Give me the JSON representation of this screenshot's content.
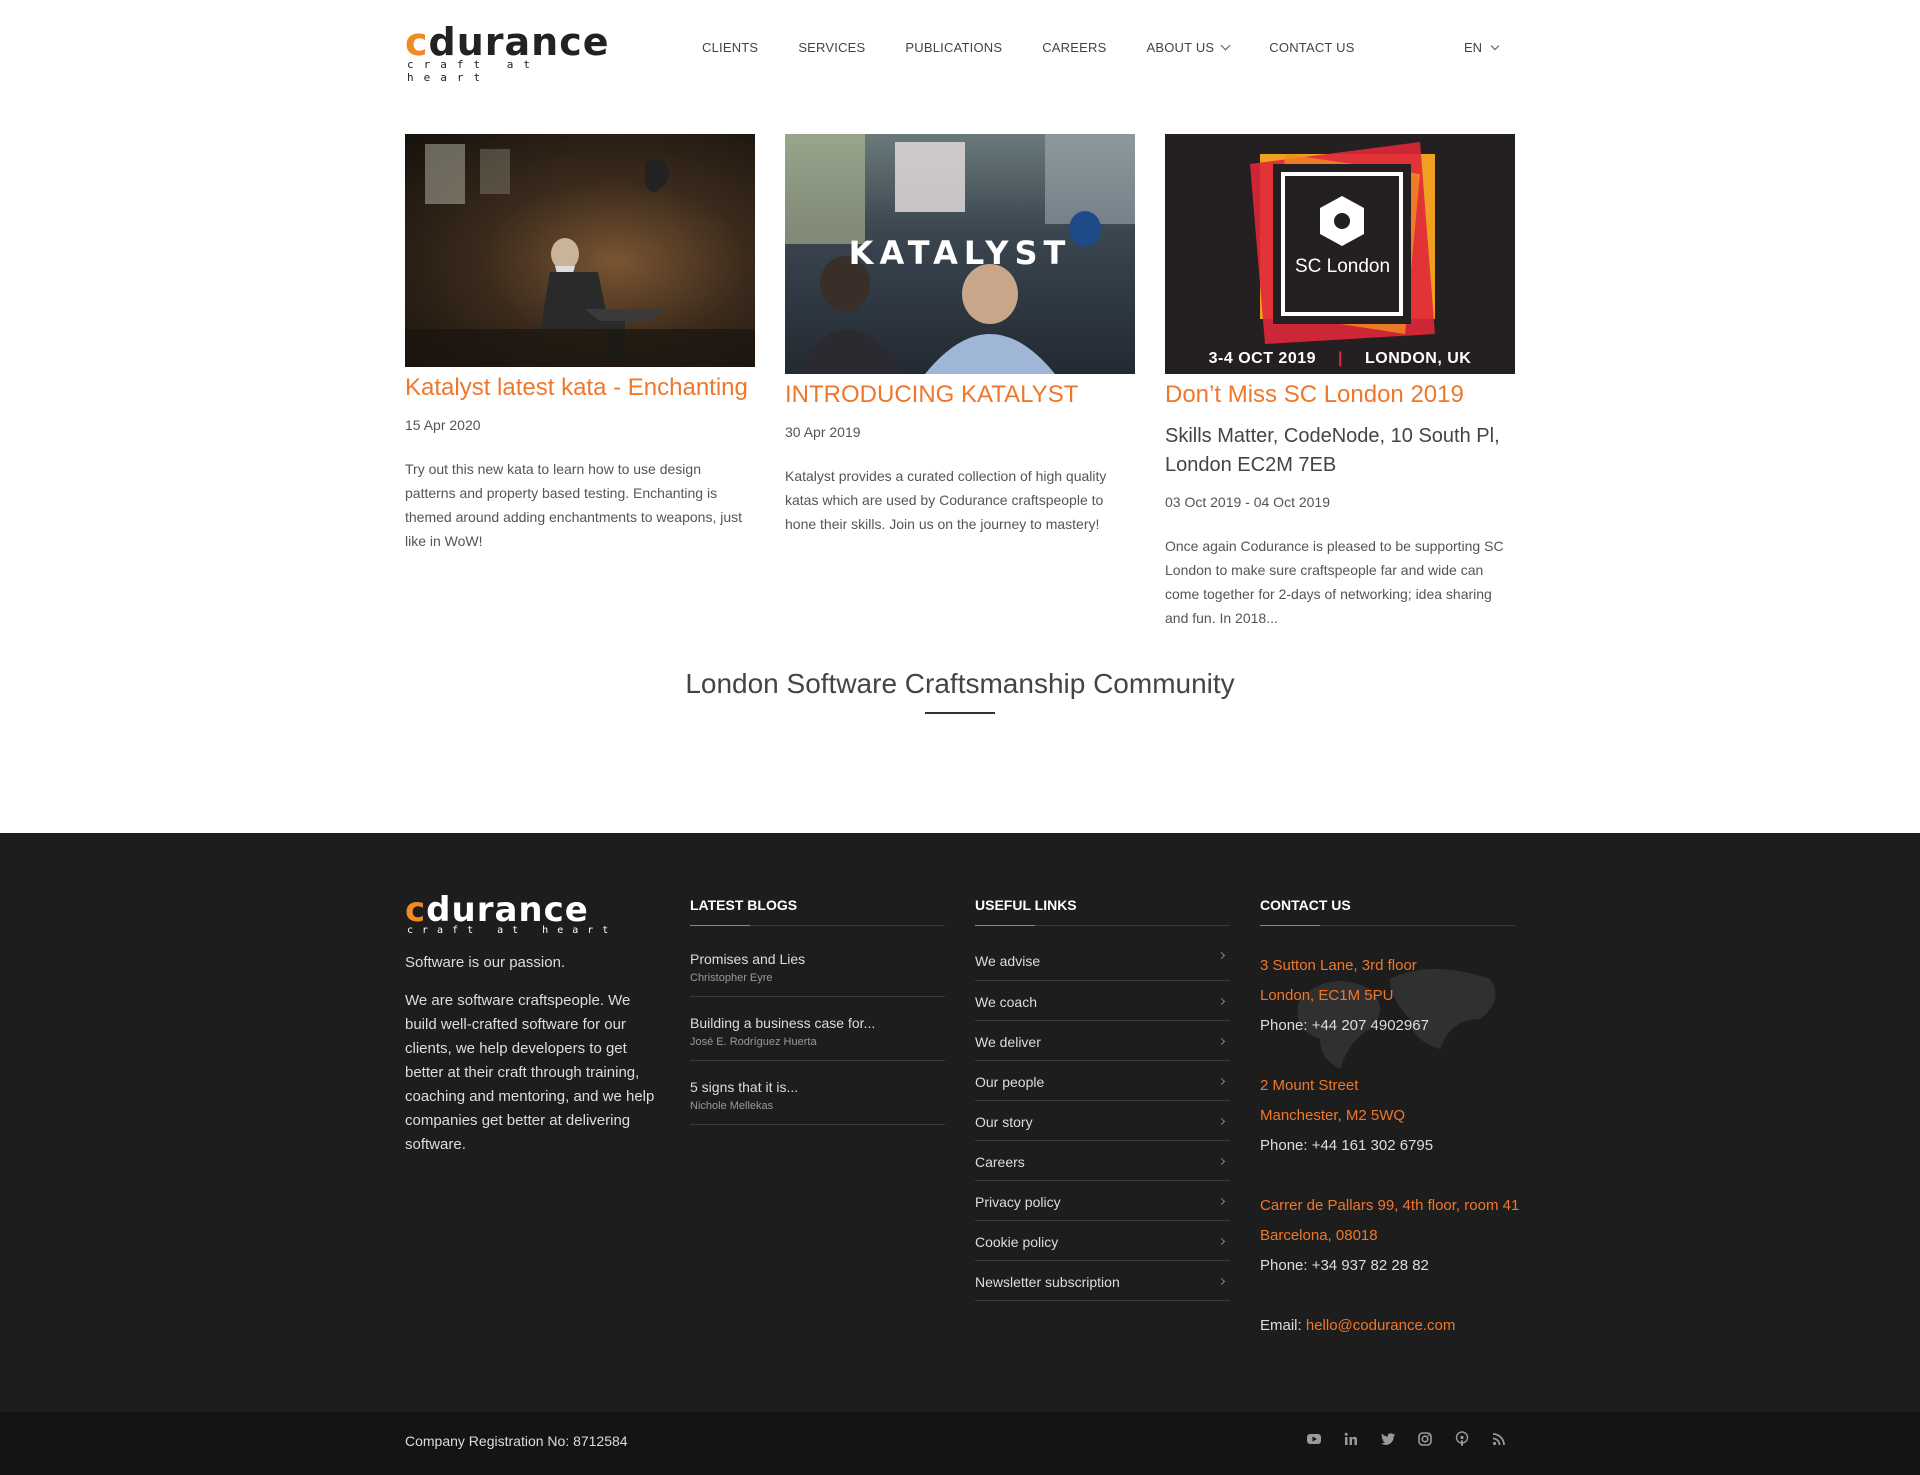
{
  "header": {
    "logo": {
      "word_a": "c",
      "word_b": "durance",
      "tagline": "craft at heart"
    },
    "nav": [
      "CLIENTS",
      "SERVICES",
      "PUBLICATIONS",
      "CAREERS",
      "ABOUT US",
      "CONTACT US"
    ],
    "language": "EN"
  },
  "cards": [
    {
      "image_text": "",
      "title": "Katalyst latest kata - Enchanting",
      "date": "15 Apr 2020",
      "description": "Try out this new kata to learn how to use design patterns and property based testing. Enchanting is themed around adding enchantments to weapons, just like in WoW!"
    },
    {
      "image_text": "KATALYST",
      "title": "INTRODUCING KATALYST",
      "date": "30 Apr 2019",
      "description": "Katalyst provides a curated collection of high quality katas which are used by Codurance craftspeople to hone their skills. Join us on the journey to mastery!"
    },
    {
      "image_text": "SC London",
      "image_footer": "3-4 OCT 2019",
      "image_footer_sep": "|",
      "image_footer_loc": "LONDON, UK",
      "title": "Don’t Miss SC London 2019",
      "venue": "Skills Matter, CodeNode, 10 South Pl, London EC2M 7EB",
      "date": "03 Oct 2019 - 04 Oct 2019",
      "description": "Once again Codurance is pleased to be supporting SC London to make sure craftspeople far and wide can come together for 2-days of networking; idea sharing and fun. In 2018..."
    }
  ],
  "community": {
    "title": "London Software Craftsmanship Community"
  },
  "footer": {
    "logo": {
      "word_a": "c",
      "word_b": "durance",
      "tagline": "craft at heart"
    },
    "about": {
      "line1": "Software is our passion.",
      "line2": "We are software craftspeople. We build well-crafted software for our clients, we help developers to get better at their craft through training, coaching and mentoring, and we help companies get better at delivering software."
    },
    "blogs_title": "LATEST BLOGS",
    "blogs": [
      {
        "title": "Promises and Lies",
        "author": "Christopher Eyre"
      },
      {
        "title": "Building a business case for...",
        "author": "José E. Rodríguez Huerta"
      },
      {
        "title": "5 signs that it is...",
        "author": "Nichole Mellekas"
      }
    ],
    "links_title": "USEFUL LINKS",
    "links": [
      "We advise",
      "We coach",
      "We deliver",
      "Our people",
      "Our story",
      "Careers",
      "Privacy policy",
      "Cookie policy",
      "Newsletter subscription"
    ],
    "contact_title": "CONTACT US",
    "offices": [
      {
        "line1": "3 Sutton Lane, 3rd floor",
        "line2": "London, EC1M 5PU",
        "phone": "Phone: +44 207 4902967"
      },
      {
        "line1": "2 Mount Street",
        "line2": "Manchester, M2 5WQ",
        "phone": "Phone: +44 161 302 6795"
      },
      {
        "line1": "Carrer de Pallars 99, 4th floor, room 41",
        "line2": "Barcelona, 08018",
        "phone": "Phone: +34 937 82 28 82"
      }
    ],
    "email_label": "Email:",
    "email": "hello@codurance.com"
  },
  "bottom": {
    "registration": "Company Registration No: 8712584",
    "social": [
      "youtube-icon",
      "linkedin-icon",
      "twitter-icon",
      "instagram-icon",
      "podcast-icon",
      "rss-icon"
    ]
  },
  "colors": {
    "accent": "#f0772a",
    "footer_bg": "#1d1d1d",
    "bottom_bg": "#141414"
  }
}
